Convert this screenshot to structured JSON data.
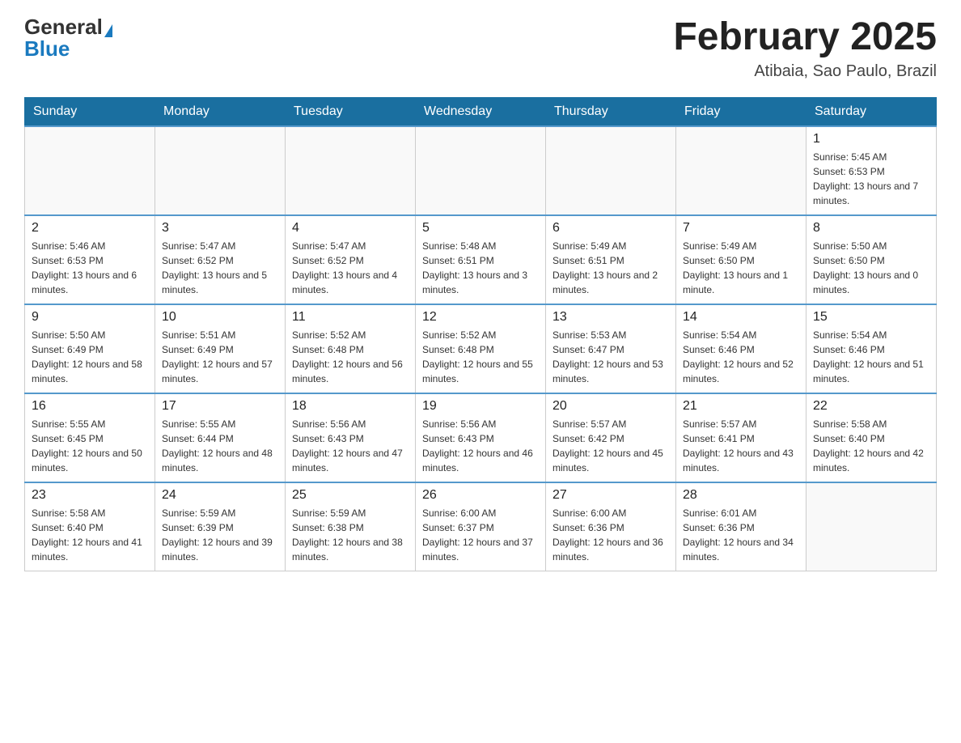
{
  "header": {
    "logo_general": "General",
    "logo_blue": "Blue",
    "month_title": "February 2025",
    "location": "Atibaia, Sao Paulo, Brazil"
  },
  "weekdays": [
    "Sunday",
    "Monday",
    "Tuesday",
    "Wednesday",
    "Thursday",
    "Friday",
    "Saturday"
  ],
  "weeks": [
    [
      {
        "day": "",
        "info": ""
      },
      {
        "day": "",
        "info": ""
      },
      {
        "day": "",
        "info": ""
      },
      {
        "day": "",
        "info": ""
      },
      {
        "day": "",
        "info": ""
      },
      {
        "day": "",
        "info": ""
      },
      {
        "day": "1",
        "info": "Sunrise: 5:45 AM\nSunset: 6:53 PM\nDaylight: 13 hours and 7 minutes."
      }
    ],
    [
      {
        "day": "2",
        "info": "Sunrise: 5:46 AM\nSunset: 6:53 PM\nDaylight: 13 hours and 6 minutes."
      },
      {
        "day": "3",
        "info": "Sunrise: 5:47 AM\nSunset: 6:52 PM\nDaylight: 13 hours and 5 minutes."
      },
      {
        "day": "4",
        "info": "Sunrise: 5:47 AM\nSunset: 6:52 PM\nDaylight: 13 hours and 4 minutes."
      },
      {
        "day": "5",
        "info": "Sunrise: 5:48 AM\nSunset: 6:51 PM\nDaylight: 13 hours and 3 minutes."
      },
      {
        "day": "6",
        "info": "Sunrise: 5:49 AM\nSunset: 6:51 PM\nDaylight: 13 hours and 2 minutes."
      },
      {
        "day": "7",
        "info": "Sunrise: 5:49 AM\nSunset: 6:50 PM\nDaylight: 13 hours and 1 minute."
      },
      {
        "day": "8",
        "info": "Sunrise: 5:50 AM\nSunset: 6:50 PM\nDaylight: 13 hours and 0 minutes."
      }
    ],
    [
      {
        "day": "9",
        "info": "Sunrise: 5:50 AM\nSunset: 6:49 PM\nDaylight: 12 hours and 58 minutes."
      },
      {
        "day": "10",
        "info": "Sunrise: 5:51 AM\nSunset: 6:49 PM\nDaylight: 12 hours and 57 minutes."
      },
      {
        "day": "11",
        "info": "Sunrise: 5:52 AM\nSunset: 6:48 PM\nDaylight: 12 hours and 56 minutes."
      },
      {
        "day": "12",
        "info": "Sunrise: 5:52 AM\nSunset: 6:48 PM\nDaylight: 12 hours and 55 minutes."
      },
      {
        "day": "13",
        "info": "Sunrise: 5:53 AM\nSunset: 6:47 PM\nDaylight: 12 hours and 53 minutes."
      },
      {
        "day": "14",
        "info": "Sunrise: 5:54 AM\nSunset: 6:46 PM\nDaylight: 12 hours and 52 minutes."
      },
      {
        "day": "15",
        "info": "Sunrise: 5:54 AM\nSunset: 6:46 PM\nDaylight: 12 hours and 51 minutes."
      }
    ],
    [
      {
        "day": "16",
        "info": "Sunrise: 5:55 AM\nSunset: 6:45 PM\nDaylight: 12 hours and 50 minutes."
      },
      {
        "day": "17",
        "info": "Sunrise: 5:55 AM\nSunset: 6:44 PM\nDaylight: 12 hours and 48 minutes."
      },
      {
        "day": "18",
        "info": "Sunrise: 5:56 AM\nSunset: 6:43 PM\nDaylight: 12 hours and 47 minutes."
      },
      {
        "day": "19",
        "info": "Sunrise: 5:56 AM\nSunset: 6:43 PM\nDaylight: 12 hours and 46 minutes."
      },
      {
        "day": "20",
        "info": "Sunrise: 5:57 AM\nSunset: 6:42 PM\nDaylight: 12 hours and 45 minutes."
      },
      {
        "day": "21",
        "info": "Sunrise: 5:57 AM\nSunset: 6:41 PM\nDaylight: 12 hours and 43 minutes."
      },
      {
        "day": "22",
        "info": "Sunrise: 5:58 AM\nSunset: 6:40 PM\nDaylight: 12 hours and 42 minutes."
      }
    ],
    [
      {
        "day": "23",
        "info": "Sunrise: 5:58 AM\nSunset: 6:40 PM\nDaylight: 12 hours and 41 minutes."
      },
      {
        "day": "24",
        "info": "Sunrise: 5:59 AM\nSunset: 6:39 PM\nDaylight: 12 hours and 39 minutes."
      },
      {
        "day": "25",
        "info": "Sunrise: 5:59 AM\nSunset: 6:38 PM\nDaylight: 12 hours and 38 minutes."
      },
      {
        "day": "26",
        "info": "Sunrise: 6:00 AM\nSunset: 6:37 PM\nDaylight: 12 hours and 37 minutes."
      },
      {
        "day": "27",
        "info": "Sunrise: 6:00 AM\nSunset: 6:36 PM\nDaylight: 12 hours and 36 minutes."
      },
      {
        "day": "28",
        "info": "Sunrise: 6:01 AM\nSunset: 6:36 PM\nDaylight: 12 hours and 34 minutes."
      },
      {
        "day": "",
        "info": ""
      }
    ]
  ]
}
